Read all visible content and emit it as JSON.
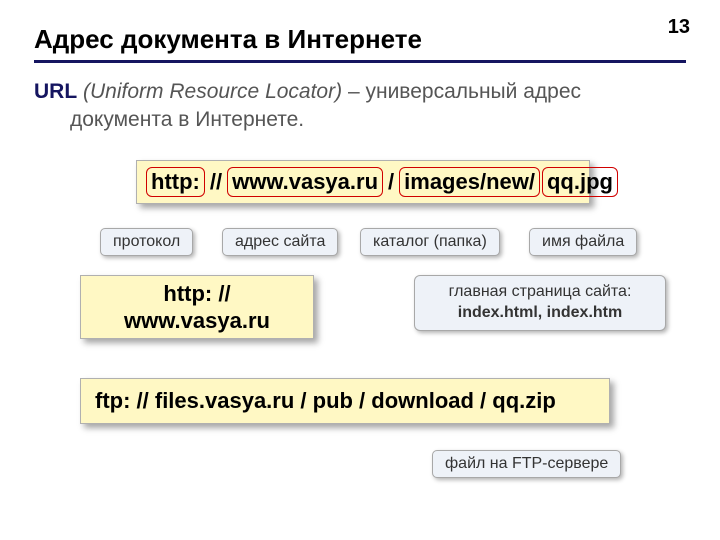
{
  "page_number": "13",
  "title": "Адрес документа в Интернете",
  "intro": {
    "url_label": "URL",
    "expansion": "(Uniform Resource Locator)",
    "dash": " – ",
    "rest1": "универсальный адрес",
    "rest2": "документа в Интернете."
  },
  "url_parts": {
    "protocol": "http:",
    "sep1": " // ",
    "host": "www.vasya.ru",
    "sep2": " / ",
    "path": "images/new/",
    "file": "qq.jpg"
  },
  "tags": {
    "protocol": "протокол",
    "host": "адрес сайта",
    "path": "каталог (папка)",
    "file": "имя файла"
  },
  "box2": {
    "line1": "http: //",
    "line2": "www.vasya.ru"
  },
  "info": {
    "line1": "главная страница сайта:",
    "line2": "index.html, index.htm"
  },
  "ftp": "ftp: // files.vasya.ru / pub / download / qq.zip",
  "ftp_tag": "файл на FTP-сервере"
}
